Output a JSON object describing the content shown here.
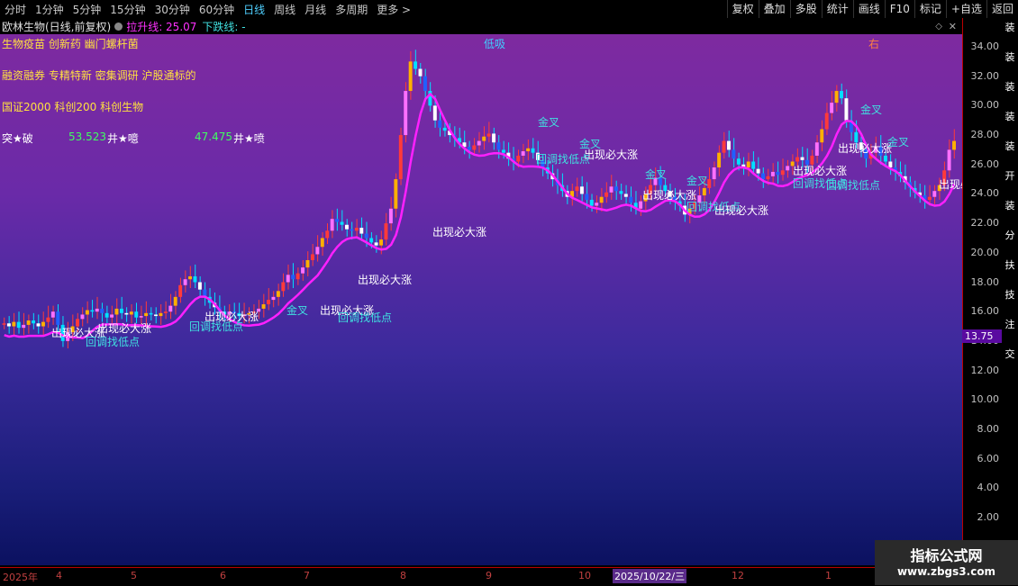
{
  "toolbar": {
    "periods": [
      "分时",
      "1分钟",
      "5分钟",
      "15分钟",
      "30分钟",
      "60分钟",
      "日线",
      "周线",
      "月线",
      "多周期",
      "更多 >"
    ],
    "active_index": 6,
    "right_buttons": [
      "复权",
      "叠加",
      "多股",
      "统计",
      "画线",
      "F10",
      "标记",
      "+自选",
      "返回"
    ]
  },
  "info": {
    "title": "欧林生物(日线,前复权)",
    "up_line_label": "拉升线: 25.07",
    "down_line_label": "下跌线: -"
  },
  "overlay": {
    "line1": "生物疫苗 创新药 幽门螺杆菌",
    "line2": "融资融券 专精特新 密集调研 沪股通标的",
    "line3": "国证2000 科创200 科创生物",
    "line4_a": "突★破",
    "line4_b": "53.523",
    "line4_c": "井★噫",
    "line4_d": "47.475",
    "line4_e": "井★喷",
    "low_buy": "低吸",
    "right_label": "右"
  },
  "annotations": {
    "surge": "出现必大涨",
    "golden_cross": "金叉",
    "pullback": "回调找低点"
  },
  "yaxis": {
    "ticks": [
      "34.00",
      "32.00",
      "30.00",
      "28.00",
      "26.00",
      "24.00",
      "22.00",
      "20.00",
      "18.00",
      "16.00",
      "14.00",
      "12.00",
      "10.00",
      "8.00",
      "6.00",
      "4.00",
      "2.00"
    ],
    "current_price": "13.75"
  },
  "xaxis": {
    "labels": [
      "2025年",
      "4",
      "5",
      "6",
      "7",
      "8",
      "9",
      "10",
      "12",
      "1"
    ],
    "selected_date": "2025/10/22/三"
  },
  "right_strip": [
    "装",
    "装",
    "装",
    "装",
    "装",
    "开",
    "装",
    "分",
    "扶",
    "技",
    "注",
    "交"
  ],
  "watermark": {
    "line1": "指标公式网",
    "line2": "www.zbgs3.com"
  },
  "colors": {
    "up_candle": "#ff3a3a",
    "down_candle": "#00e0ff",
    "magenta_line": "#ff20ff",
    "green_cloud": "#0a8a5a",
    "red_cloud": "#a03030",
    "yellow_text": "#ffe040",
    "cyan_text": "#40e0e0"
  }
}
